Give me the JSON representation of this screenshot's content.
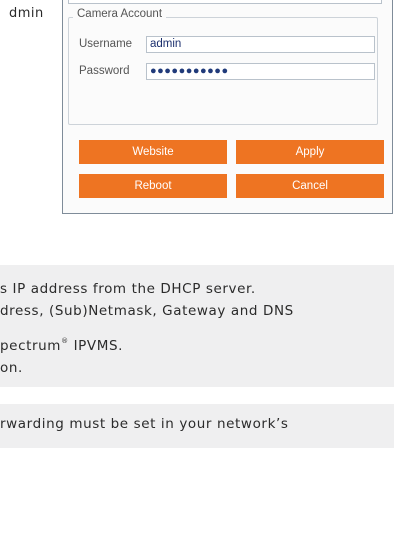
{
  "top_fragment": "dmin",
  "camera_account": {
    "legend": "Camera Account",
    "username_label": "Username",
    "username_value": "admin",
    "password_label": "Password",
    "password_dots": "●●●●●●●●●●●"
  },
  "buttons": {
    "website": "Website",
    "apply": "Apply",
    "reboot": "Reboot",
    "cancel": "Cancel"
  },
  "notes": {
    "line1": "s IP address from the DHCP server.",
    "line2": "dress, (Sub)Netmask, Gateway and DNS",
    "line3_prefix": "pectrum",
    "line3_reg": "®",
    "line3_suffix": " IPVMS.",
    "line4": "on.",
    "line5": "rwarding must be set in your network’s"
  },
  "colors": {
    "button_orange": "#ee7422",
    "panel_border": "#7f8c99",
    "note_background": "#efeff0"
  }
}
